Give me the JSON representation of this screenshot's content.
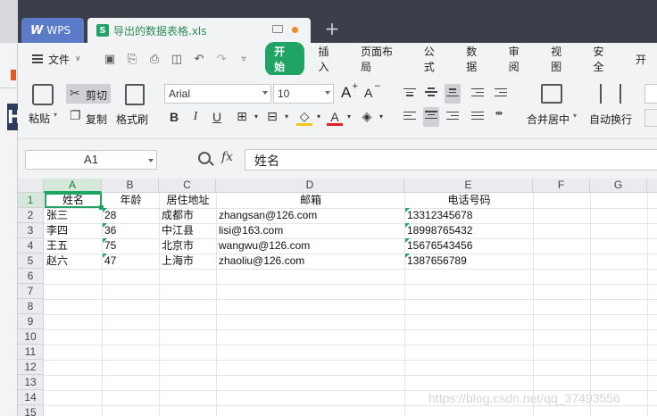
{
  "app": {
    "app_tab": "WPS",
    "doc_tab": "导出的数据表格.xls",
    "new_tab_symbol": "+"
  },
  "menu": {
    "file": "文件",
    "tabs": [
      "开始",
      "插入",
      "页面布局",
      "公式",
      "数据",
      "审阅",
      "视图",
      "安全",
      "开"
    ],
    "active_index": 0
  },
  "ribbon": {
    "paste": "粘贴",
    "cut": "剪切",
    "copy": "复制",
    "format_painter": "格式刷",
    "font_name": "Arial",
    "font_size": "10",
    "bold": "B",
    "italic": "I",
    "underline": "U",
    "merge_center": "合并居中",
    "wrap_text": "自动换行",
    "grow_font": "A",
    "shrink_font": "A"
  },
  "formula": {
    "name_box": "A1",
    "fx": "fx",
    "content": "姓名"
  },
  "sheet": {
    "columns": [
      "A",
      "B",
      "C",
      "D",
      "E",
      "F",
      "G"
    ],
    "rows": [
      "1",
      "2",
      "3",
      "4",
      "5",
      "6",
      "7",
      "8",
      "9",
      "10",
      "11",
      "12",
      "13",
      "14",
      "15"
    ],
    "header": [
      "姓名",
      "年龄",
      "居住地址",
      "邮箱",
      "电话号码"
    ],
    "data": [
      [
        "张三",
        "28",
        "成都市",
        "zhangsan@126.com",
        "13312345678"
      ],
      [
        "李四",
        "36",
        "中江县",
        "lisi@163.com",
        "18998765432"
      ],
      [
        "王五",
        "75",
        "北京市",
        "wangwu@126.com",
        "15676543456"
      ],
      [
        "赵六",
        "47",
        "上海市",
        "zhaoliu@126.com",
        "1387656789"
      ]
    ]
  },
  "watermark": "https://blog.csdn.net/qq_37493556",
  "colors": {
    "accent": "#1fa463",
    "titlebar": "#3b3f4a",
    "wps_tab": "#5b7bc9"
  }
}
